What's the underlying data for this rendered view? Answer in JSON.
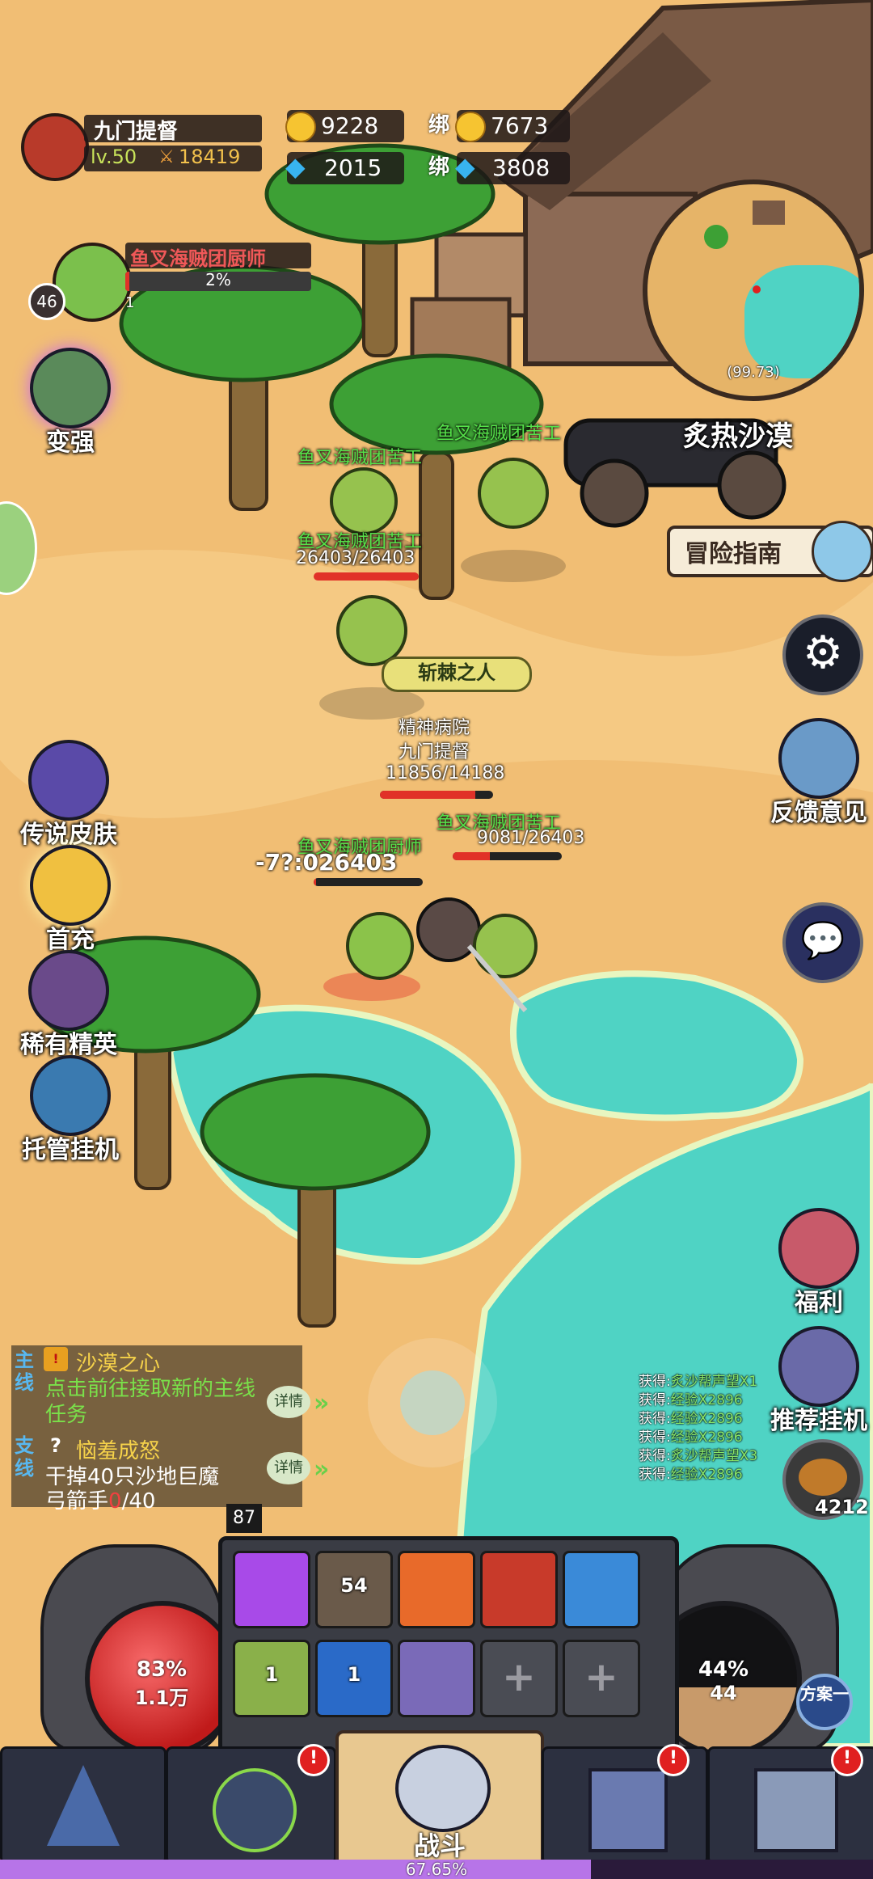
{
  "player": {
    "name": "九门提督",
    "level": "lv.50",
    "power": "18419"
  },
  "currency": {
    "gold": "9228",
    "bound_label_1": "绑",
    "bound_gold": "7673",
    "diamond": "2015",
    "bound_label_2": "绑",
    "bound_diamond": "3808"
  },
  "target": {
    "name": "鱼叉海贼团厨师",
    "percent": "2%",
    "level": "46",
    "count": "1"
  },
  "minimap": {
    "coords": "(99.73)",
    "zone": "炙热沙漠"
  },
  "left_menu": {
    "strengthen": "变强",
    "legend_skin": "传说皮肤",
    "first_recharge": "首充",
    "rare_elite": "稀有精英",
    "auto_idle": "托管挂机"
  },
  "right_menu": {
    "adventure_guide": "冒险指南",
    "feedback": "反馈意见",
    "welfare": "福利",
    "recommend_idle": "推荐挂机",
    "bread_count": "4212"
  },
  "units": {
    "worker1": "鱼叉海贼团苦工",
    "worker2": "鱼叉海贼团苦工",
    "worker3_name": "鱼叉海贼团苦工",
    "worker3_hp": "26403/26403",
    "title_badge": "斩棘之人",
    "guild": "精神病院",
    "player_name": "九门提督",
    "player_hp": "11856/14188",
    "worker4_name": "鱼叉海贼团苦工",
    "worker4_hp": "9081/26403",
    "cook_name": "鱼叉海贼团厨师",
    "cook_hp": "-7?:026403"
  },
  "quests": {
    "main_tag": "主线",
    "main_title": "沙漠之心",
    "main_desc": "点击前往接取新的主线任务",
    "main_detail": "详情",
    "side_tag": "支线",
    "side_title": "恼羞成怒",
    "side_desc": "干掉40只沙地巨魔",
    "side_desc2_pre": "弓箭手",
    "side_progress": "0",
    "side_desc2_post": "/40",
    "side_detail": "详情"
  },
  "loot_log": [
    {
      "prefix": "获得:",
      "item": "炙沙帮声望X1"
    },
    {
      "prefix": "获得:",
      "item": "经验X2896"
    },
    {
      "prefix": "获得:",
      "item": "经验X2896"
    },
    {
      "prefix": "获得:",
      "item": "经验X2896"
    },
    {
      "prefix": "获得:",
      "item": "炙沙帮声望X3"
    },
    {
      "prefix": "获得:",
      "item": "经验X2896"
    }
  ],
  "hud": {
    "skill_level": "87",
    "hp_percent": "83%",
    "hp_value": "1.1万",
    "mp_percent": "44%",
    "mp_value": "44",
    "scheme": "方案一",
    "skill_counts": [
      "",
      "54",
      "",
      "",
      "",
      "1",
      "1",
      "",
      "",
      ""
    ],
    "exp_percent": "67.65%",
    "exp_fraction": 0.6765
  },
  "nav": {
    "battle": "战斗",
    "badge": "!"
  },
  "colors": {
    "sand": "#f1be74",
    "water": "#4fd3c4",
    "name_green": "#56e24a",
    "hp_red": "#e13128",
    "exp_purple": "#b774e8"
  }
}
